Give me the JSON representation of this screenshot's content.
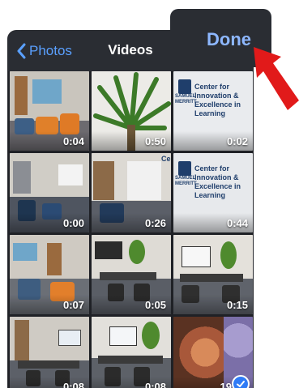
{
  "nav": {
    "back_label": "Photos",
    "title": "Videos",
    "done_label": "Done"
  },
  "videos": [
    {
      "duration": "0:04"
    },
    {
      "duration": "0:50"
    },
    {
      "duration": "0:02"
    },
    {
      "duration": "0:00"
    },
    {
      "duration": "0:26"
    },
    {
      "duration": "0:44"
    },
    {
      "duration": "0:07"
    },
    {
      "duration": "0:05"
    },
    {
      "duration": "0:15"
    },
    {
      "duration": "0:08"
    },
    {
      "duration": "0:08"
    },
    {
      "duration": "19",
      "selected": true
    }
  ],
  "logo_text": {
    "org_line1": "SAMUEL",
    "org_line2": "MERRITT",
    "center_line1": "Center for Innovation &",
    "center_line2": "Excellence in Learning"
  },
  "colors": {
    "accent": "#5aa0ff",
    "done": "#8db7ff",
    "arrow": "#e11a1a",
    "check": "#2f7bf6"
  }
}
